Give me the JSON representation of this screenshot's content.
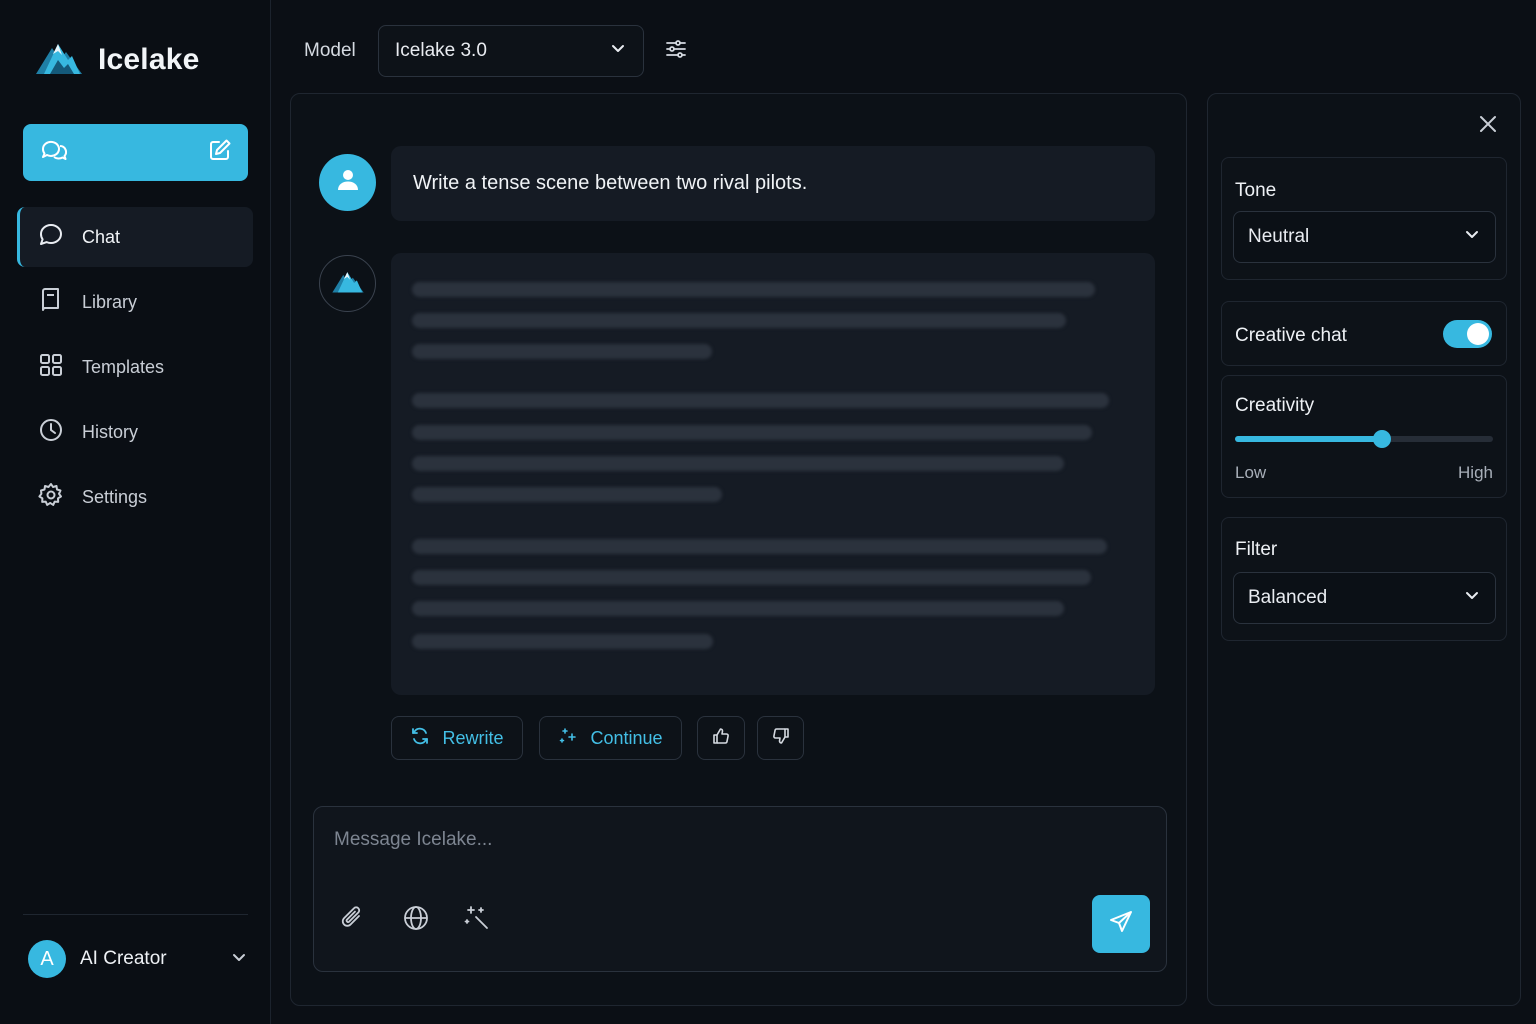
{
  "app": {
    "name": "Icelake"
  },
  "sidebar": {
    "new_chat_label": "",
    "items": [
      {
        "label": "Chat",
        "icon": "chat-bubble-icon",
        "active": true
      },
      {
        "label": "Library",
        "icon": "book-icon",
        "active": false
      },
      {
        "label": "Templates",
        "icon": "grid-icon",
        "active": false
      },
      {
        "label": "History",
        "icon": "clock-icon",
        "active": false
      },
      {
        "label": "Settings",
        "icon": "gear-icon",
        "active": false
      }
    ],
    "user": {
      "initial": "A",
      "name": "AI Creator"
    }
  },
  "topbar": {
    "model_label": "Model",
    "model_value": "Icelake 3.0"
  },
  "conversation": {
    "user_message": "Write a tense scene between two rival pilots.",
    "actions": {
      "rewrite": "Rewrite",
      "continue": "Continue"
    }
  },
  "composer": {
    "placeholder": "Message Icelake..."
  },
  "settings": {
    "tone": {
      "label": "Tone",
      "value": "Neutral"
    },
    "creative_chat": {
      "label": "Creative chat",
      "enabled": true
    },
    "creativity": {
      "label": "Creativity",
      "low": "Low",
      "high": "High",
      "level": 0.57
    },
    "filter": {
      "label": "Filter",
      "value": "Balanced"
    }
  },
  "colors": {
    "accent": "#37b8e0",
    "background": "#0b0f15",
    "panel": "#0c1117",
    "bubble": "#151b24"
  }
}
